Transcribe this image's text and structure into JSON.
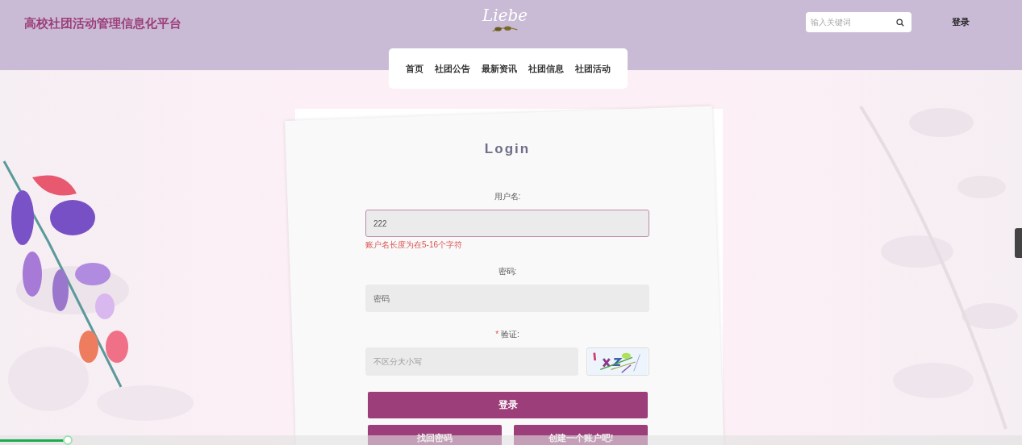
{
  "header": {
    "site_title": "高校社团活动管理信息化平台",
    "logo_text": "Liebe",
    "search": {
      "placeholder": "输入关键词"
    },
    "login_link": "登录"
  },
  "nav": [
    {
      "label": "首页"
    },
    {
      "label": "社团公告"
    },
    {
      "label": "最新资讯"
    },
    {
      "label": "社团信息"
    },
    {
      "label": "社团活动"
    }
  ],
  "login_form": {
    "title": "Login",
    "fields": [
      {
        "kind": "text",
        "label": "用户名:",
        "value": "222",
        "focused": true,
        "error": "账户名长度为在5-16个字符"
      },
      {
        "kind": "password",
        "label": "密码:",
        "placeholder": "密码",
        "focused": false
      },
      {
        "kind": "captcha",
        "label": "验证:",
        "required_mark": "*",
        "placeholder": "不区分大小写",
        "focused": false
      }
    ],
    "submit": "登录",
    "secondary_buttons": [
      "找回密码",
      "创建一个账户吧!"
    ]
  },
  "player": {
    "level": 0.066
  }
}
